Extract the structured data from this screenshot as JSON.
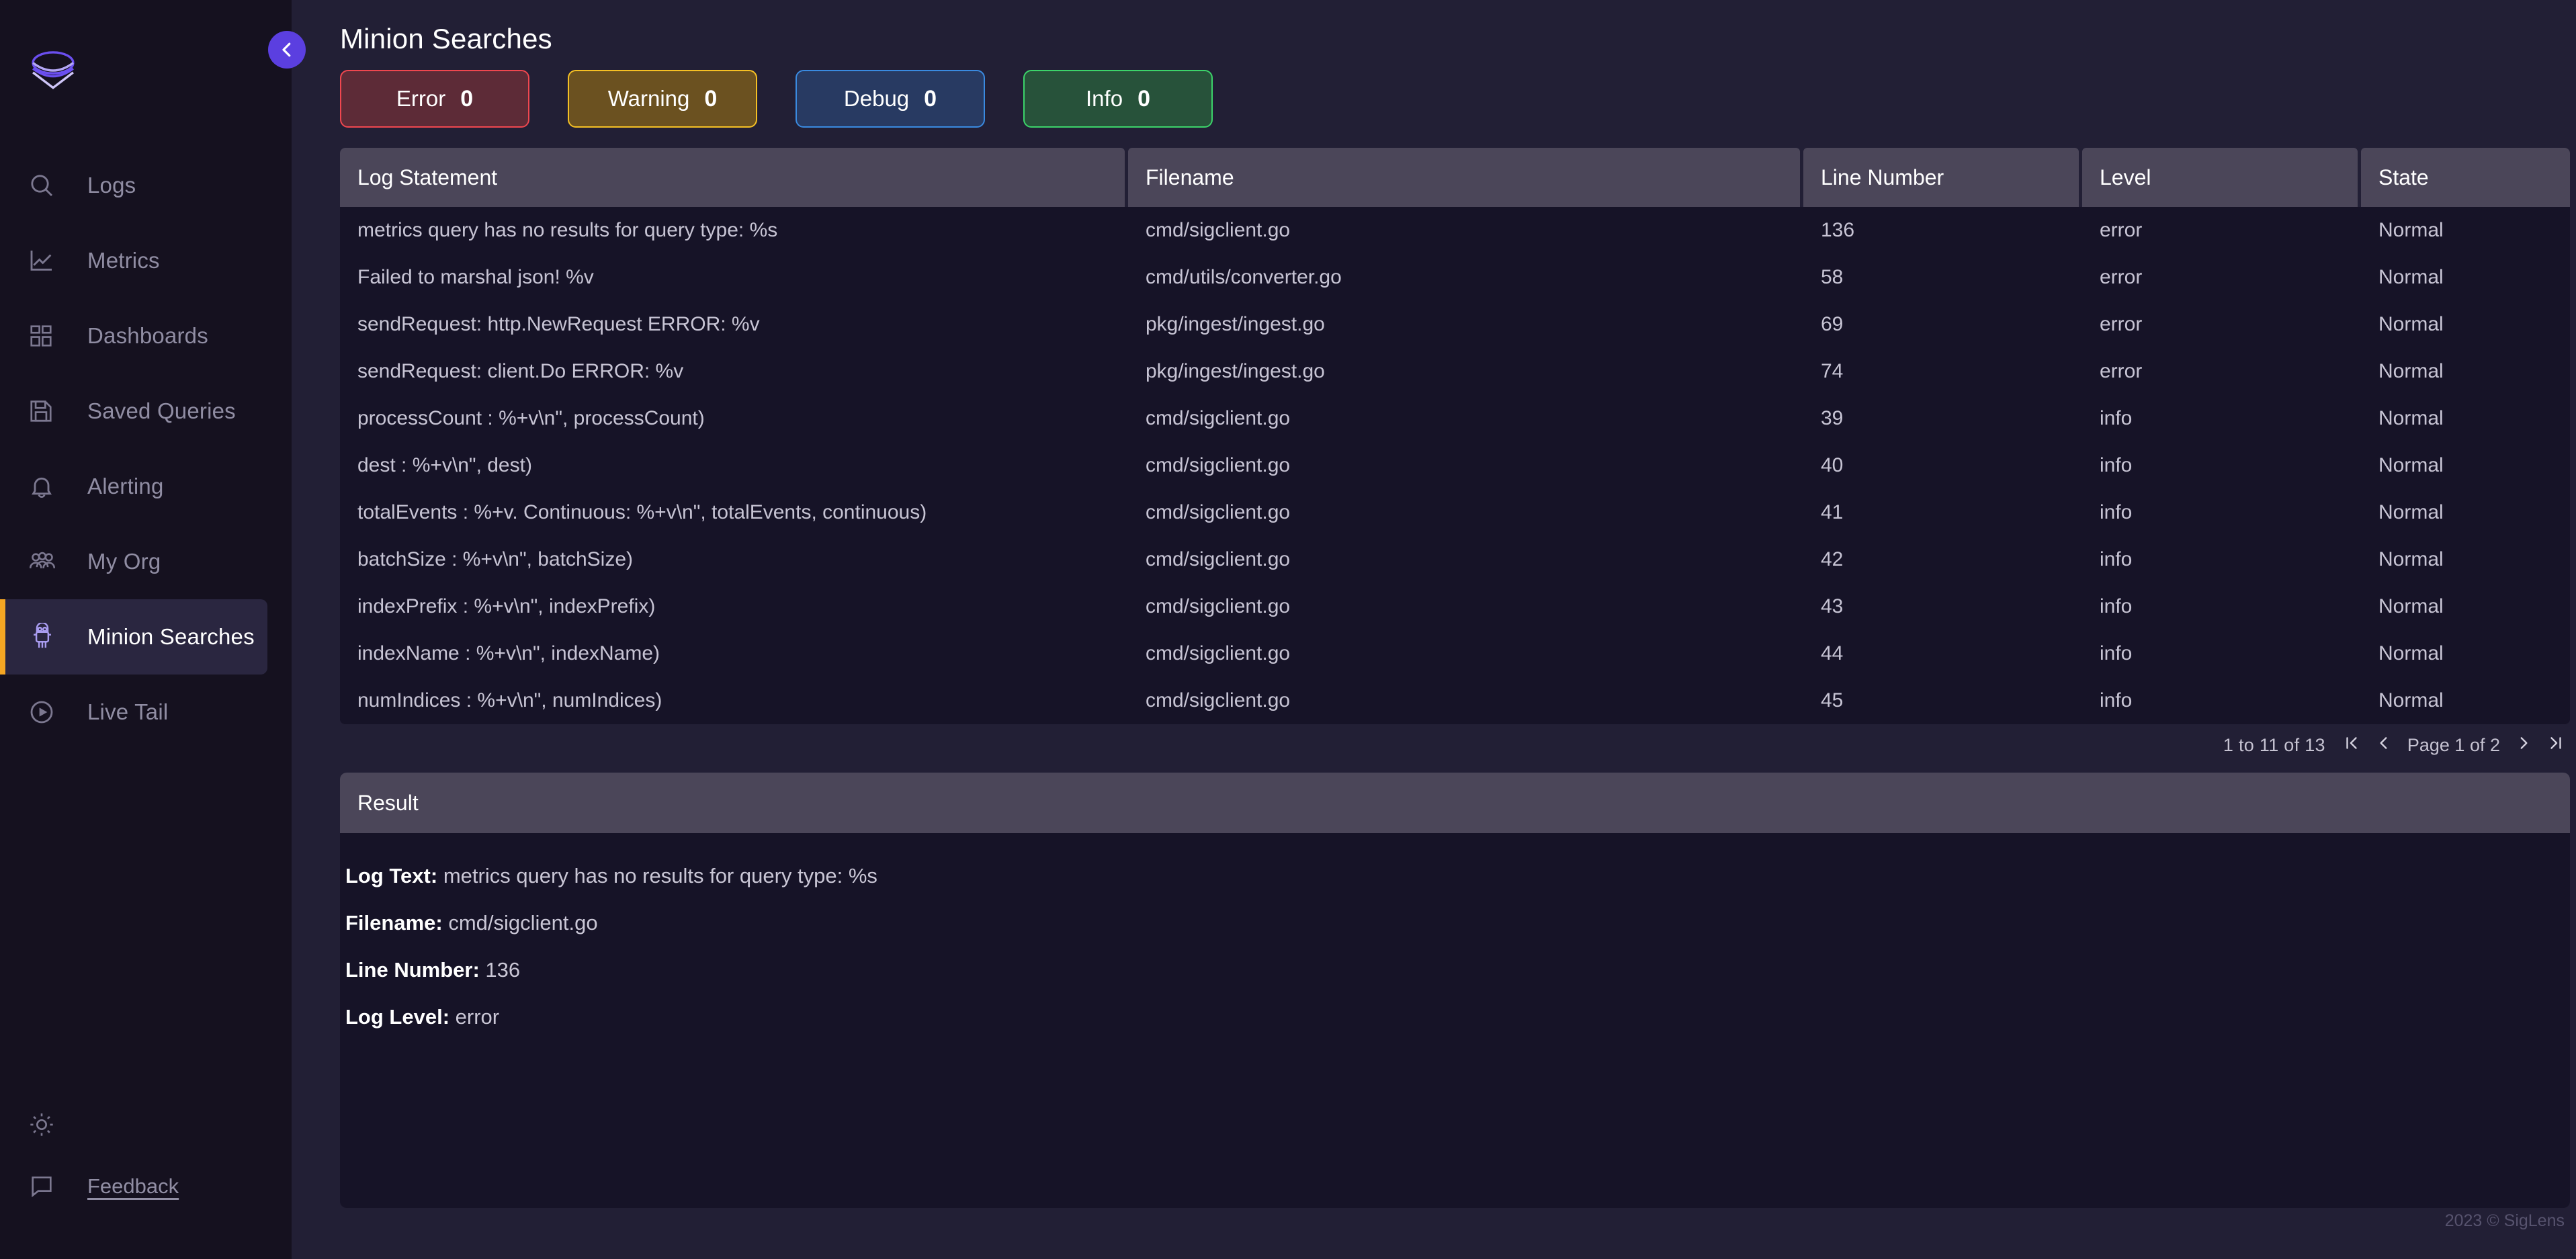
{
  "sidebar": {
    "logo_name": "siglens-layers-logo",
    "items": [
      {
        "label": "Logs",
        "icon": "search-icon",
        "active": false
      },
      {
        "label": "Metrics",
        "icon": "line-chart-icon",
        "active": false
      },
      {
        "label": "Dashboards",
        "icon": "grid-icon",
        "active": false
      },
      {
        "label": "Saved Queries",
        "icon": "save-disk-icon",
        "active": false
      },
      {
        "label": "Alerting",
        "icon": "bell-icon",
        "active": false
      },
      {
        "label": "My Org",
        "icon": "users-icon",
        "active": false
      },
      {
        "label": "Minion Searches",
        "icon": "minion-icon",
        "active": true
      },
      {
        "label": "Live Tail",
        "icon": "play-circle-icon",
        "active": false
      }
    ],
    "bottom": [
      {
        "label": "",
        "icon": "sun-theme-icon"
      },
      {
        "label": "Feedback",
        "icon": "chat-bubble-icon"
      }
    ]
  },
  "collapse_button": {
    "icon": "chevron-left-icon"
  },
  "header": {
    "title": "Minion Searches",
    "filters": [
      {
        "label": "Error",
        "count": "0",
        "key": "error"
      },
      {
        "label": "Warning",
        "count": "0",
        "key": "warning"
      },
      {
        "label": "Debug",
        "count": "0",
        "key": "debug"
      },
      {
        "label": "Info",
        "count": "0",
        "key": "info"
      }
    ]
  },
  "table": {
    "columns": [
      "Log Statement",
      "Filename",
      "Line Number",
      "Level",
      "State"
    ],
    "rows": [
      {
        "log": "metrics query has no results for query type: %s",
        "file": "cmd/sigclient.go",
        "line": "136",
        "level": "error",
        "state": "Normal"
      },
      {
        "log": "Failed to marshal json! %v",
        "file": "cmd/utils/converter.go",
        "line": "58",
        "level": "error",
        "state": "Normal"
      },
      {
        "log": "sendRequest: http.NewRequest ERROR: %v",
        "file": "pkg/ingest/ingest.go",
        "line": "69",
        "level": "error",
        "state": "Normal"
      },
      {
        "log": "sendRequest: client.Do ERROR: %v",
        "file": "pkg/ingest/ingest.go",
        "line": "74",
        "level": "error",
        "state": "Normal"
      },
      {
        "log": "processCount : %+v\\n\", processCount)",
        "file": "cmd/sigclient.go",
        "line": "39",
        "level": "info",
        "state": "Normal"
      },
      {
        "log": "dest : %+v\\n\", dest)",
        "file": "cmd/sigclient.go",
        "line": "40",
        "level": "info",
        "state": "Normal"
      },
      {
        "log": "totalEvents : %+v. Continuous: %+v\\n\", totalEvents, continuous)",
        "file": "cmd/sigclient.go",
        "line": "41",
        "level": "info",
        "state": "Normal"
      },
      {
        "log": "batchSize : %+v\\n\", batchSize)",
        "file": "cmd/sigclient.go",
        "line": "42",
        "level": "info",
        "state": "Normal"
      },
      {
        "log": "indexPrefix : %+v\\n\", indexPrefix)",
        "file": "cmd/sigclient.go",
        "line": "43",
        "level": "info",
        "state": "Normal"
      },
      {
        "log": "indexName : %+v\\n\", indexName)",
        "file": "cmd/sigclient.go",
        "line": "44",
        "level": "info",
        "state": "Normal"
      },
      {
        "log": "numIndices : %+v\\n\", numIndices)",
        "file": "cmd/sigclient.go",
        "line": "45",
        "level": "info",
        "state": "Normal"
      }
    ]
  },
  "pagination": {
    "range_text": "1 to 11 of 13",
    "first_icon": "page-first-icon",
    "prev_icon": "chevron-left-icon",
    "page_label": "Page 1 of 2",
    "next_icon": "chevron-right-icon",
    "last_icon": "page-last-icon"
  },
  "result": {
    "title": "Result",
    "fields": [
      {
        "key": "Log Text:",
        "value": "metrics query has no results for query type: %s"
      },
      {
        "key": "Filename:",
        "value": "cmd/sigclient.go"
      },
      {
        "key": "Line Number:",
        "value": "136"
      },
      {
        "key": "Log Level:",
        "value": "error"
      }
    ]
  },
  "footer": {
    "copyright": "2023 © SigLens"
  },
  "colors": {
    "accent_purple": "#5b3fe0",
    "active_bar_orange": "#f5a623",
    "error": "#f0474f",
    "warning": "#f5c024",
    "debug": "#3a8ae0",
    "info": "#3cd46a",
    "sidebar_bg": "#15111f",
    "main_bg": "#221f35",
    "panel_bg": "#161327",
    "header_bg": "#4b4659"
  }
}
